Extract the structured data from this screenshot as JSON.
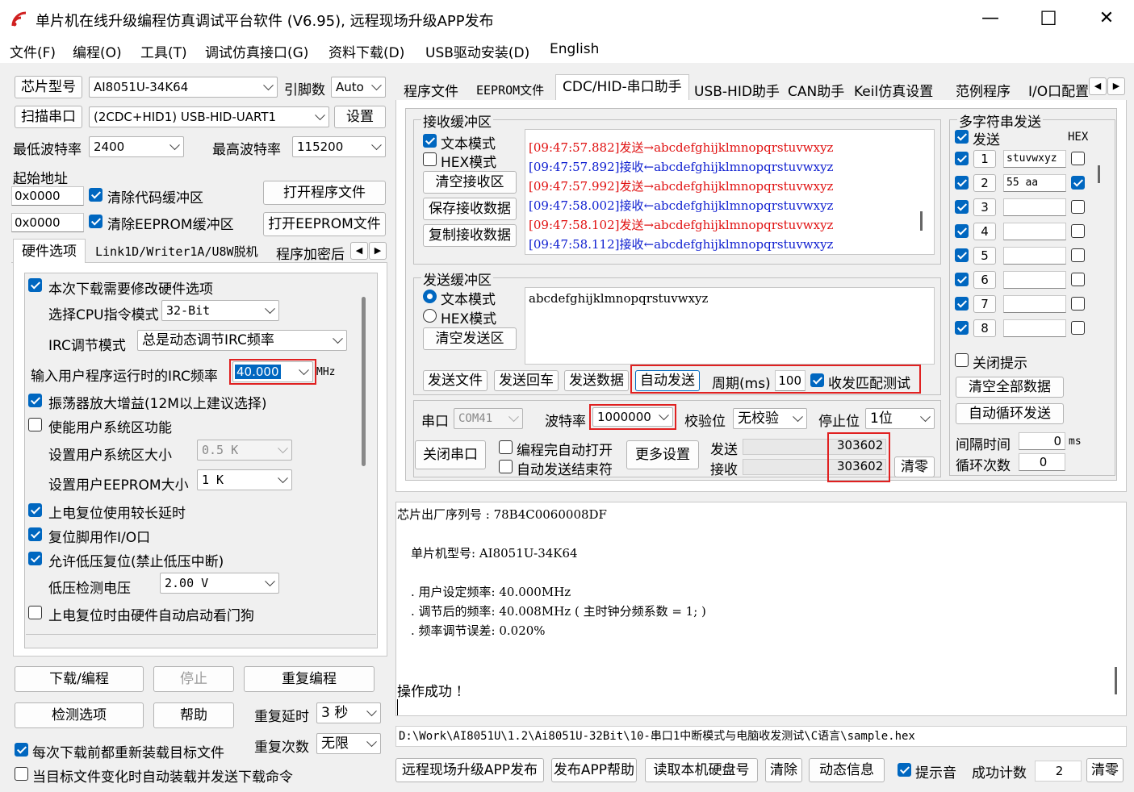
{
  "window": {
    "title": "单片机在线升级编程仿真调试平台软件 (V6.95), 远程现场升级APP发布",
    "min_glyph": "—",
    "max_glyph": "☐",
    "close_glyph": "✕"
  },
  "menu": [
    "文件(F)",
    "编程(O)",
    "工具(T)",
    "调试仿真接口(G)",
    "资料下载(D)",
    "USB驱动安装(D)",
    "English"
  ],
  "left": {
    "chip_label": "芯片型号",
    "chip_value": "AI8051U-34K64",
    "pins_label": "引脚数",
    "pins_value": "Auto",
    "scan_label": "扫描串口",
    "port_value": "(2CDC+HID1) USB-HID-UART1",
    "settings_label": "设置",
    "min_baud_label": "最低波特率",
    "min_baud": "2400",
    "max_baud_label": "最高波特率",
    "max_baud": "115200",
    "start_addr_label": "起始地址",
    "addr1": "0x0000",
    "clear_code": "清除代码缓冲区",
    "open_prog": "打开程序文件",
    "addr2": "0x0000",
    "clear_eeprom": "清除EEPROM缓冲区",
    "open_eeprom": "打开EEPROM文件",
    "tabs": [
      "硬件选项",
      "Link1D/Writer1A/U8W脱机",
      "程序加密后"
    ],
    "hw": {
      "modify_hw": "本次下载需要修改硬件选项",
      "cpu_mode_label": "选择CPU指令模式",
      "cpu_mode": "32-Bit",
      "irc_mode_label": "IRC调节模式",
      "irc_mode": "总是动态调节IRC频率",
      "irc_freq_label": "输入用户程序运行时的IRC频率",
      "irc_freq": "40.000",
      "mhz": "MHz",
      "osc_gain": "振荡器放大增益(12M以上建议选择)",
      "user_sys": "使能用户系统区功能",
      "user_sys_size_label": "设置用户系统区大小",
      "user_sys_size": "0.5 K",
      "eeprom_size_label": "设置用户EEPROM大小",
      "eeprom_size": "1   K",
      "long_reset": "上电复位使用较长延时",
      "reset_io": "复位脚用作I/O口",
      "lvd_reset": "允许低压复位(禁止低压中断)",
      "lvd_label": "低压检测电压",
      "lvd": "2.00 V",
      "wdt": "上电复位时由硬件自动启动看门狗"
    },
    "download": "下载/编程",
    "stop": "停止",
    "reprogram": "重复编程",
    "check": "检测选项",
    "help": "帮助",
    "retry_delay_label": "重复延时",
    "retry_delay": "3 秒",
    "retry_count_label": "重复次数",
    "retry_count": "无限",
    "reload": "每次下载前都重新装载目标文件",
    "auto_load": "当目标文件变化时自动装载并发送下载命令"
  },
  "tabs": [
    "程序文件",
    "EEPROM文件",
    "CDC/HID-串口助手",
    "USB-HID助手",
    "CAN助手",
    "Keil仿真设置",
    "范例程序",
    "I/O口配置"
  ],
  "recv": {
    "title": "接收缓冲区",
    "text_mode": "文本模式",
    "hex_mode": "HEX模式",
    "clear": "清空接收区",
    "save": "保存接收数据",
    "copy": "复制接收数据",
    "lines": [
      {
        "t": "[09:47:57.882]",
        "d": "发送→",
        "p": "abcdefghijklmnopqrstuvwxyz",
        "c": "red"
      },
      {
        "t": "[09:47:57.892]",
        "d": "接收←",
        "p": "abcdefghijklmnopqrstuvwxyz",
        "c": "blue"
      },
      {
        "t": "[09:47:57.992]",
        "d": "发送→",
        "p": "abcdefghijklmnopqrstuvwxyz",
        "c": "red"
      },
      {
        "t": "[09:47:58.002]",
        "d": "接收←",
        "p": "abcdefghijklmnopqrstuvwxyz",
        "c": "blue"
      },
      {
        "t": "[09:47:58.102]",
        "d": "发送→",
        "p": "abcdefghijklmnopqrstuvwxyz",
        "c": "red"
      },
      {
        "t": "[09:47:58.112]",
        "d": "接收←",
        "p": "abcdefghijklmnopqrstuvwxyz",
        "c": "blue"
      }
    ]
  },
  "send": {
    "title": "发送缓冲区",
    "text_mode": "文本模式",
    "hex_mode": "HEX模式",
    "clear": "清空发送区",
    "content": "abcdefghijklmnopqrstuvwxyz",
    "send_file": "发送文件",
    "send_cr": "发送回车",
    "send_data": "发送数据",
    "auto_send": "自动发送",
    "period_label": "周期(ms)",
    "period": "100",
    "match_test": "收发匹配测试"
  },
  "serial": {
    "port_label": "串口",
    "port": "COM41",
    "baud_label": "波特率",
    "baud": "1000000",
    "parity_label": "校验位",
    "parity": "无校验",
    "stop_label": "停止位",
    "stop": "1位",
    "close": "关闭串口",
    "auto_open": "编程完自动打开",
    "auto_send_end": "自动发送结束符",
    "more": "更多设置",
    "tx_label": "发送",
    "tx": "303602",
    "rx_label": "接收",
    "rx": "303602",
    "clear": "清零"
  },
  "multi": {
    "title": "多字符串发送",
    "send": "发送",
    "hex": "HEX",
    "rows": [
      {
        "n": "1",
        "v": "stuvwxyz",
        "hex": false
      },
      {
        "n": "2",
        "v": "55 aa",
        "hex": true
      },
      {
        "n": "3",
        "v": "",
        "hex": false
      },
      {
        "n": "4",
        "v": "",
        "hex": false
      },
      {
        "n": "5",
        "v": "",
        "hex": false
      },
      {
        "n": "6",
        "v": "",
        "hex": false
      },
      {
        "n": "7",
        "v": "",
        "hex": false
      },
      {
        "n": "8",
        "v": "",
        "hex": false
      }
    ],
    "close_tip": "关闭提示",
    "clear_all": "清空全部数据",
    "auto_loop": "自动循环发送",
    "interval_label": "间隔时间",
    "interval": "0",
    "ms": "ms",
    "loop_label": "循环次数",
    "loop": "0"
  },
  "output": {
    "serial": "芯片出厂序列号 : 78B4C0060008DF",
    "model": "单片机型号: AI8051U-34K64",
    "f1": ". 用户设定频率: 40.000MHz",
    "f2": ". 调节后的频率: 40.008MHz ( 主时钟分频系数 = 1; )",
    "f3": ". 频率调节误差: 0.020%",
    "ok": "操作成功 !"
  },
  "path": "D:\\Work\\AI8051U\\1.2\\Ai8051U-32Bit\\10-串口1中断模式与电脑收发测试\\C语言\\sample.hex",
  "bottom": {
    "remote": "远程现场升级APP发布",
    "app_help": "发布APP帮助",
    "disk": "读取本机硬盘号",
    "clear": "清除",
    "dyn": "动态信息",
    "sound": "提示音",
    "count_label": "成功计数",
    "count": "2",
    "zero": "清零"
  }
}
